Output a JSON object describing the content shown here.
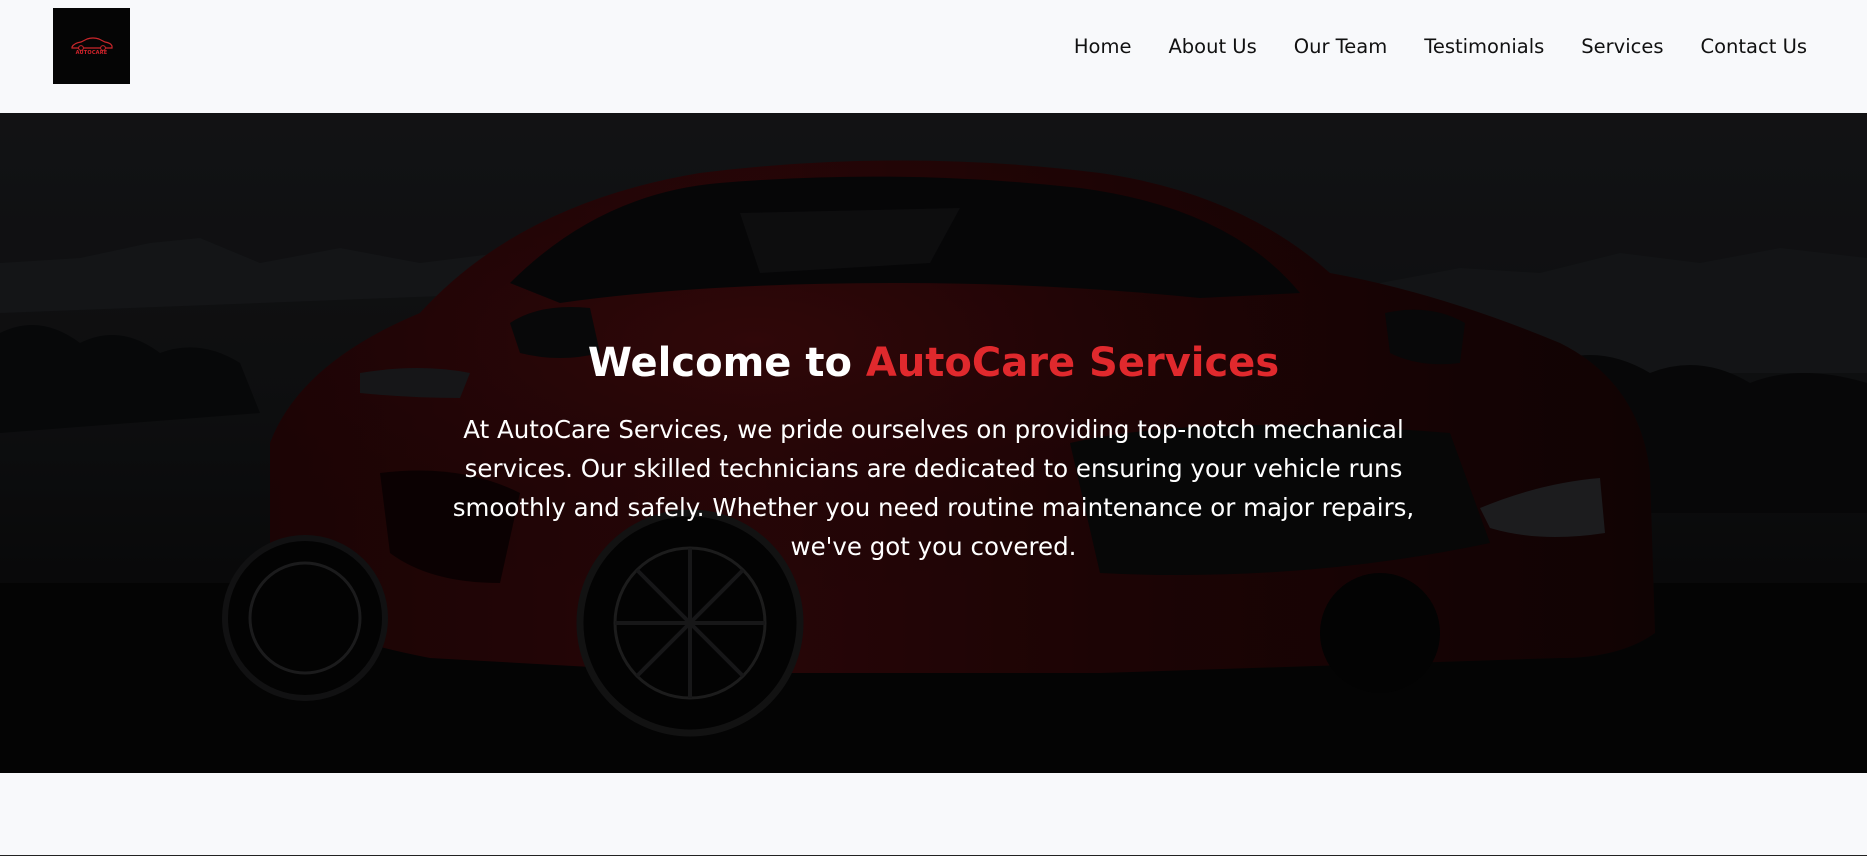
{
  "brand": {
    "logo_alt": "AUTOCARE",
    "logo_icon": "car-logo-icon"
  },
  "nav": {
    "items": [
      {
        "label": "Home"
      },
      {
        "label": "About Us"
      },
      {
        "label": "Our Team"
      },
      {
        "label": "Testimonials"
      },
      {
        "label": "Services"
      },
      {
        "label": "Contact Us"
      }
    ]
  },
  "hero": {
    "title_prefix": "Welcome to ",
    "title_brand": "AutoCare Services",
    "description": "At AutoCare Services, we pride ourselves on providing top-notch mechanical services. Our skilled technicians are dedicated to ensuring your vehicle runs smoothly and safely. Whether you need routine maintenance or major repairs, we've got you covered.",
    "background": "dark-red-sports-car-image"
  },
  "colors": {
    "accent": "#e0292d",
    "header_bg": "#f8f9fb",
    "hero_overlay": "#0d0d0e"
  }
}
